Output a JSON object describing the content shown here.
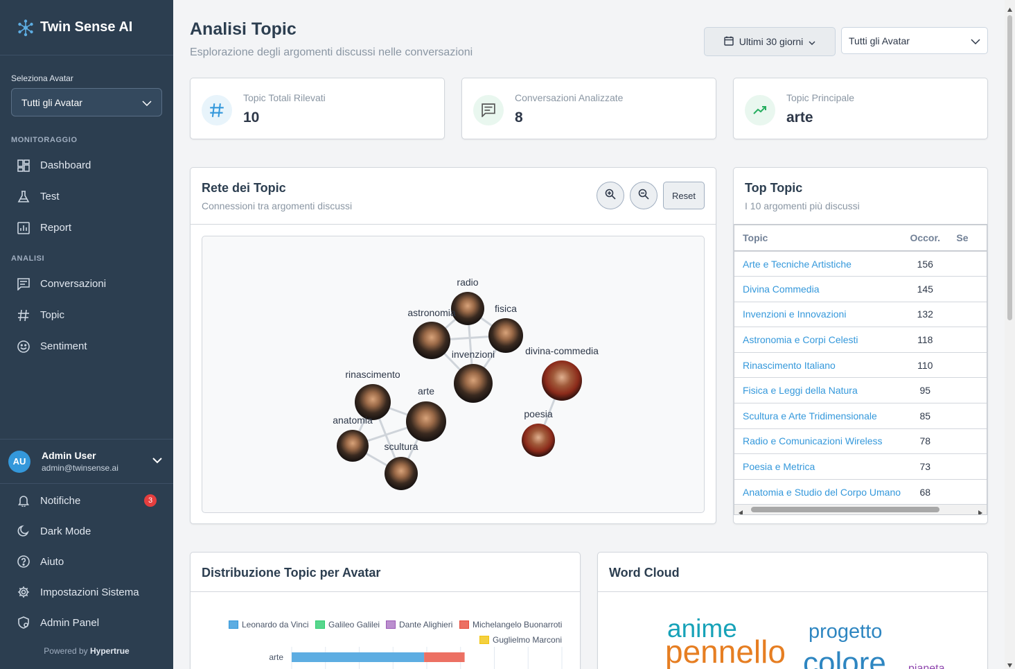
{
  "brand": {
    "name": "Twin Sense AI"
  },
  "sidebar": {
    "select_label": "Seleziona Avatar",
    "select_value": "Tutti gli Avatar",
    "section_monitoring": "MONITORAGGIO",
    "monitoring_items": [
      {
        "label": "Dashboard",
        "icon": "dashboard-icon"
      },
      {
        "label": "Test",
        "icon": "flask-icon"
      },
      {
        "label": "Report",
        "icon": "report-icon"
      }
    ],
    "section_analysis": "ANALISI",
    "analysis_items": [
      {
        "label": "Conversazioni",
        "icon": "chat-icon"
      },
      {
        "label": "Topic",
        "icon": "hash-icon"
      },
      {
        "label": "Sentiment",
        "icon": "smile-icon"
      }
    ],
    "user": {
      "initials": "AU",
      "name": "Admin User",
      "email": "admin@twinsense.ai"
    },
    "bottom_items": [
      {
        "label": "Notifiche",
        "icon": "bell-icon",
        "badge": "3"
      },
      {
        "label": "Dark Mode",
        "icon": "moon-icon"
      },
      {
        "label": "Aiuto",
        "icon": "help-icon"
      },
      {
        "label": "Impostazioni Sistema",
        "icon": "gear-icon"
      },
      {
        "label": "Admin Panel",
        "icon": "admin-icon"
      }
    ],
    "powered_prefix": "Powered by",
    "powered_brand": "Hypertrue"
  },
  "header": {
    "title": "Analisi Topic",
    "subtitle": "Esplorazione degli argomenti discussi nelle conversazioni",
    "date_filter": "Ultimi 30 giorni",
    "avatar_filter": "Tutti gli Avatar"
  },
  "stats": [
    {
      "label": "Topic Totali Rilevati",
      "value": "10",
      "icon": "hash-icon",
      "color": "#3498db"
    },
    {
      "label": "Conversazioni Analizzate",
      "value": "8",
      "icon": "chat-icon",
      "color": "#2ecc71"
    },
    {
      "label": "Topic Principale",
      "value": "arte",
      "icon": "trend-up-icon",
      "color": "#27ae60"
    }
  ],
  "network": {
    "title": "Rete dei Topic",
    "subtitle": "Connessioni tra argomenti discussi",
    "reset_label": "Reset",
    "nodes": [
      "radio",
      "fisica",
      "astronomia",
      "invenzioni",
      "divina-commedia",
      "rinascimento",
      "arte",
      "anatomia",
      "scultura",
      "poesia"
    ]
  },
  "top_topics": {
    "title": "Top Topic",
    "subtitle": "I 10 argomenti più discussi",
    "columns": [
      "Topic",
      "Occor.",
      "Se"
    ],
    "rows": [
      {
        "topic": "Arte e Tecniche Artistiche",
        "count": "156"
      },
      {
        "topic": "Divina Commedia",
        "count": "145"
      },
      {
        "topic": "Invenzioni e Innovazioni",
        "count": "132"
      },
      {
        "topic": "Astronomia e Corpi Celesti",
        "count": "118"
      },
      {
        "topic": "Rinascimento Italiano",
        "count": "110"
      },
      {
        "topic": "Fisica e Leggi della Natura",
        "count": "95"
      },
      {
        "topic": "Scultura e Arte Tridimensionale",
        "count": "85"
      },
      {
        "topic": "Radio e Comunicazioni Wireless",
        "count": "78"
      },
      {
        "topic": "Poesia e Metrica",
        "count": "73"
      },
      {
        "topic": "Anatomia e Studio del Corpo Umano",
        "count": "68"
      }
    ]
  },
  "distribution": {
    "title": "Distribuzione Topic per Avatar",
    "legend": [
      {
        "name": "Leonardo da Vinci",
        "color": "#5dade2"
      },
      {
        "name": "Galileo Galilei",
        "color": "#58d68d"
      },
      {
        "name": "Dante Alighieri",
        "color": "#bb8fce"
      },
      {
        "name": "Michelangelo Buonarroti",
        "color": "#ec7063"
      },
      {
        "name": "Guglielmo Marconi",
        "color": "#f4d03f"
      }
    ]
  },
  "chart_data": {
    "type": "bar",
    "orientation": "horizontal",
    "stacked": true,
    "categories": [
      "arte"
    ],
    "series": [
      {
        "name": "Leonardo da Vinci",
        "values": [
          98
        ]
      },
      {
        "name": "Michelangelo Buonarroti",
        "values": [
          30
        ]
      }
    ],
    "xlim": [
      0,
      200
    ],
    "grid": true,
    "legend": "top"
  },
  "wordcloud": {
    "title": "Word Cloud",
    "words": [
      {
        "text": "anime",
        "color": "#17a2b8"
      },
      {
        "text": "progetto",
        "color": "#2e86c1"
      },
      {
        "text": "pennello",
        "color": "#e67e22"
      },
      {
        "text": "colore",
        "color": "#2e86c1"
      },
      {
        "text": "pianeta",
        "color": "#8e44ad"
      }
    ]
  }
}
